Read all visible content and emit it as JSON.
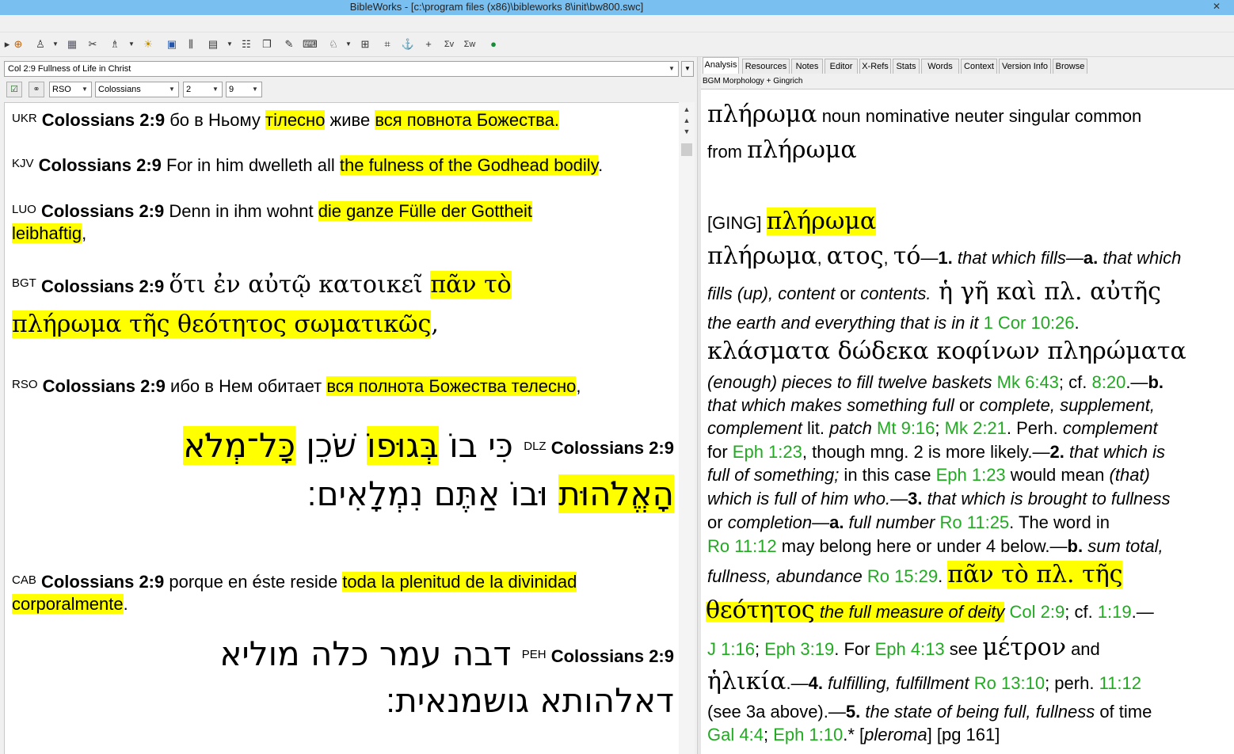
{
  "window": {
    "title": "BibleWorks - [c:\\program files (x86)\\bibleworks 8\\init\\bw800.swc]"
  },
  "toolbar": {
    "icons": [
      "target-icon",
      "person-search-icon",
      "version-icon",
      "book-icon",
      "tools-icon",
      "lamp-icon",
      "window-icon",
      "parallel-icon",
      "grid-icon",
      "list-icon",
      "copy-icon",
      "notes-icon",
      "keyboard-icon",
      "person-icon",
      "layout-icon",
      "diagram-icon",
      "anchor-icon",
      "plus-icon",
      "verb-icon",
      "word-icon",
      "globe-icon"
    ]
  },
  "left": {
    "reference": "Col 2:9 Fullness of Life in Christ",
    "version": "RSO",
    "book": "Colossians",
    "chapter": "2",
    "verse": "9",
    "verses": [
      {
        "ver": "UKR",
        "ref": "Colossians 2:9",
        "pre": " бо в Ньому ",
        "hl1": "тілесно",
        "mid": " живе ",
        "hl2": "вся повнота Божества."
      },
      {
        "ver": "KJV",
        "ref": "Colossians 2:9",
        "pre": " For in him dwelleth all ",
        "hl": "the fulness of the Godhead bodily",
        "post": "."
      },
      {
        "ver": "LUO",
        "ref": "Colossians 2:9",
        "pre": " Denn in ihm wohnt ",
        "hl": "die ganze Fülle der Gottheit",
        "hl_line2": "leibhaftig",
        "post": ","
      },
      {
        "ver": "BGT",
        "ref": "Colossians 2:9",
        "pre": "ὅτι ἐν αὐτῷ κατοικεῖ ",
        "hl": "πᾶν τὸ",
        "hl_line2": "πλήρωμα τῆς θεότητος σωματικῶς",
        "post": ","
      },
      {
        "ver": "RSO",
        "ref": "Colossians 2:9",
        "pre": " ибо в Нем обитает ",
        "hl": "вся полнота Божества телесно",
        "post": ","
      },
      {
        "ver": "DLZ",
        "ref": "Colossians 2:9",
        "pre": "כִּי בוֹ ",
        "hl1": "בְּגוּפוֹ",
        "mid": " שֹׁכֵן ",
        "hl2": "כָּל־מְלֹא",
        "line2_hl": "הָאֱלֹהוּת",
        "line2_post": " וּבוֹ אַתֶּם נִמְלָאִים׃"
      },
      {
        "ver": "CAB",
        "ref": "Colossians 2:9",
        "pre": " porque en éste reside ",
        "hl": "toda la plenitud de la divinidad",
        "hl_line2": "corporalmente",
        "post": "."
      },
      {
        "ver": "PEH",
        "ref": "Colossians 2:9",
        "line1": "דבה עמר כלה מוליא",
        "line2": "דאלהותא גושמנאית׃"
      }
    ]
  },
  "right": {
    "tabs": [
      "Analysis",
      "Resources",
      "Notes",
      "Editor",
      "X-Refs",
      "Stats",
      "Words",
      "Context",
      "Version Info",
      "Browse"
    ],
    "subtitle": "BGM Morphology + Gingrich",
    "lemma": "πλήρωμα",
    "parse": "noun nominative neuter singular common",
    "from_label": "from",
    "from_lemma": "πλήρωμα",
    "ging_label": "[GING]",
    "ging_lemma": "πλήρωμα",
    "entry": {
      "l1_g": "πλήρωμα",
      "l1_a": ", ",
      "l1_g2": "ατος",
      "l1_b": ", ",
      "l1_g3": "τό",
      "l1_c": "—",
      "l1_n1": "1.",
      "l1_i1": " that which fills",
      "l1_d": "—",
      "l1_na": "a.",
      "l1_i2": " that which",
      "l2_i1": "fills (up), content",
      "l2_a": " or ",
      "l2_i2": "contents.",
      "l2_g": " ἡ γῆ καὶ πλ. αὐτῆς",
      "l3_i": "the earth and everything that is in it",
      "l3_ref": "1 Cor 10:26",
      "l3_end": ".",
      "l4_g": "κλάσματα δώδεκα κοφίνων πληρώματα",
      "l5_i": "(enough) pieces to fill twelve baskets",
      "l5_ref1": "Mk 6:43",
      "l5_a": "; cf. ",
      "l5_ref2": "8:20",
      "l5_b": ".—",
      "l5_nb": "b.",
      "l6_i1": "that which makes something full",
      "l6_a": " or ",
      "l6_i2": "complete, supplement,",
      "l7_i1": "complement",
      "l7_a": " lit. ",
      "l7_i2": "patch",
      "l7_ref1": "Mt 9:16",
      "l7_b": "; ",
      "l7_ref2": "Mk 2:21",
      "l7_c": ". Perh. ",
      "l7_i3": "complement",
      "l8_a": "for ",
      "l8_ref": "Eph 1:23",
      "l8_b": ", though mng. 2 is more likely.—",
      "l8_n": "2.",
      "l8_i": " that which is",
      "l9_i1": "full of something;",
      "l9_a": " in this case ",
      "l9_ref": "Eph 1:23",
      "l9_b": " would mean ",
      "l9_i2": "(that)",
      "l10_i1": "which is full of him who.",
      "l10_a": "—",
      "l10_n": "3.",
      "l10_i2": " that which is brought to fullness",
      "l11_a": "or ",
      "l11_i1": "completion",
      "l11_b": "—",
      "l11_n": "a.",
      "l11_i2": " full number",
      "l11_ref": "Ro 11:25",
      "l11_c": ". The word in",
      "l12_ref": "Ro 11:12",
      "l12_a": " may belong here or under 4 below.—",
      "l12_n": "b.",
      "l12_i": " sum total,",
      "l13_i": "fullness, abundance",
      "l13_ref": "Ro 15:29",
      "l13_a": ". ",
      "l13_hlg": "πᾶν τὸ πλ. τῆς",
      "l14_hlg": "θεότητος",
      "l14_hli": " the full measure of deity",
      "l14_ref1": "Col 2:9",
      "l14_a": "; cf. ",
      "l14_ref2": "1:19",
      "l14_b": ".—",
      "l15_ref1": "J 1:16",
      "l15_a": "; ",
      "l15_ref2": "Eph 3:19",
      "l15_b": ". For ",
      "l15_ref3": "Eph 4:13",
      "l15_c": " see ",
      "l15_g": "μέτρον",
      "l15_d": " and",
      "l16_g": "ἡλικία",
      "l16_a": ".—",
      "l16_n": "4.",
      "l16_i1": " fulfilling, fulfillment",
      "l16_ref1": "Ro 13:10",
      "l16_b": "; perh. ",
      "l16_ref2": "11:12",
      "l17_a": "(see 3a above).—",
      "l17_n": "5.",
      "l17_i1": " the state of being full, fullness",
      "l17_b": " of time",
      "l18_ref1": "Gal 4:4",
      "l18_a": "; ",
      "l18_ref2": "Eph 1:10",
      "l18_b": ".* [",
      "l18_i": "pleroma",
      "l18_c": "] [pg 161]"
    }
  }
}
